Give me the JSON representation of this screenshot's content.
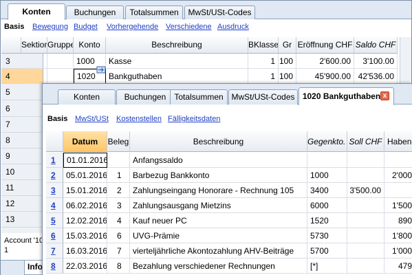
{
  "outer": {
    "tabs": [
      "Konten",
      "Buchungen",
      "Totalsummen",
      "MwSt/USt-Codes"
    ],
    "active_tab": "Konten",
    "subnav": {
      "active": "Basis",
      "links": [
        "Bewegung",
        "Budget",
        "Vorhergehende",
        "Verschiedene",
        "Ausdruck"
      ]
    },
    "columns": [
      "Sektion",
      "Gruppe",
      "Konto",
      "Beschreibung",
      "BKlasse",
      "Gr",
      "Eröffnung CHF",
      "Saldo CHF"
    ],
    "row_numbers": [
      "3",
      "4",
      "5",
      "6",
      "7",
      "8",
      "9",
      "10",
      "11",
      "12",
      "13"
    ],
    "rows": [
      {
        "konto": "1000",
        "beschreibung": "Kasse",
        "bklasse": "1",
        "gr": "100",
        "eroeffnung": "2'600.00",
        "saldo": "3'100.00"
      },
      {
        "konto": "1020",
        "beschreibung": "Bankguthaben",
        "bklasse": "1",
        "gr": "100",
        "eroeffnung": "45'900.00",
        "saldo": "42'536.00"
      }
    ],
    "info_text": "Account '10",
    "info_second": "1",
    "info_tab": "Info"
  },
  "inner": {
    "tabs": [
      "Konten",
      "Buchungen",
      "Totalsummen",
      "MwSt/USt-Codes"
    ],
    "active_tab": "1020 Bankguthaben",
    "close_label": "x",
    "subnav": {
      "active": "Basis",
      "links": [
        "MwSt/USt",
        "Kostenstellen",
        "Fälligkeitsdaten"
      ]
    },
    "columns": {
      "datum": "Datum",
      "beleg": "Beleg",
      "beschreibung": "Beschreibung",
      "gegenkonto": "Gegenkto.",
      "soll": "Soll CHF",
      "haben": "Haben"
    },
    "rows": [
      {
        "nr": "1",
        "datum": "01.01.2016",
        "beleg": "",
        "beschreibung": "Anfangssaldo",
        "gegenkonto": "",
        "soll": "",
        "haben": ""
      },
      {
        "nr": "2",
        "datum": "05.01.2016",
        "beleg": "1",
        "beschreibung": "Barbezug Bankkonto",
        "gegenkonto": "1000",
        "soll": "",
        "haben": "2'000"
      },
      {
        "nr": "3",
        "datum": "15.01.2016",
        "beleg": "2",
        "beschreibung": "Zahlungseingang Honorare - Rechnung 105",
        "gegenkonto": "3400",
        "soll": "3'500.00",
        "haben": ""
      },
      {
        "nr": "4",
        "datum": "06.02.2016",
        "beleg": "3",
        "beschreibung": "Zahlungsausgang Mietzins",
        "gegenkonto": "6000",
        "soll": "",
        "haben": "1'500"
      },
      {
        "nr": "5",
        "datum": "12.02.2016",
        "beleg": "4",
        "beschreibung": "Kauf neuer PC",
        "gegenkonto": "1520",
        "soll": "",
        "haben": "890"
      },
      {
        "nr": "6",
        "datum": "15.03.2016",
        "beleg": "6",
        "beschreibung": "UVG-Prämie",
        "gegenkonto": "5730",
        "soll": "",
        "haben": "1'800"
      },
      {
        "nr": "7",
        "datum": "16.03.2016",
        "beleg": "7",
        "beschreibung": "vierteljährliche Akontozahlung AHV-Beiträge",
        "gegenkonto": "5700",
        "soll": "",
        "haben": "1'000"
      },
      {
        "nr": "8",
        "datum": "22.03.2016",
        "beleg": "8",
        "beschreibung": "Bezahlung verschiedener Rechnungen",
        "gegenkonto": "[*]",
        "soll": "",
        "haben": "479"
      }
    ]
  },
  "colors": {
    "accent_tab": "#ffffff",
    "selected_header": "#ffc766",
    "selected_row": "#ffd79a",
    "link": "#1f3fc4"
  }
}
